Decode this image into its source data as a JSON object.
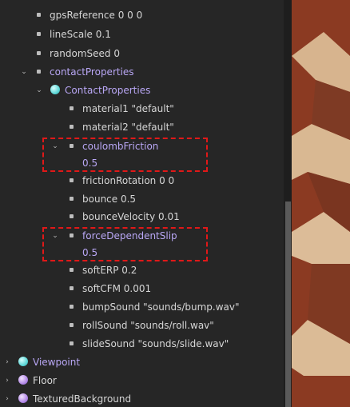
{
  "tree": {
    "rows": [
      {
        "label": "gpsReference 0 0 0"
      },
      {
        "label": "lineScale 0.1"
      },
      {
        "label": "randomSeed 0"
      },
      {
        "label": "contactProperties"
      },
      {
        "label": "ContactProperties"
      },
      {
        "label": "material1 \"default\""
      },
      {
        "label": "material2 \"default\""
      },
      {
        "label": "coulombFriction"
      },
      {
        "label": "0.5"
      },
      {
        "label": "frictionRotation 0 0"
      },
      {
        "label": "bounce 0.5"
      },
      {
        "label": "bounceVelocity 0.01"
      },
      {
        "label": "forceDependentSlip"
      },
      {
        "label": "0.5"
      },
      {
        "label": "softERP 0.2"
      },
      {
        "label": "softCFM 0.001"
      },
      {
        "label": "bumpSound \"sounds/bump.wav\""
      },
      {
        "label": "rollSound \"sounds/roll.wav\""
      },
      {
        "label": "slideSound \"sounds/slide.wav\""
      },
      {
        "label": "Viewpoint"
      },
      {
        "label": "Floor"
      },
      {
        "label": "TexturedBackground"
      }
    ]
  },
  "colors": {
    "field_text": "#d6d6d6",
    "node_text": "#b9a7f5",
    "highlight_border": "#e01818",
    "panel_bg": "#262626"
  },
  "icons": {
    "expanded": "chevron-down-icon",
    "collapsed": "chevron-right-icon",
    "field": "bullet-icon",
    "node_cyan": "cyan-node-icon",
    "node_purple": "purple-node-icon"
  }
}
